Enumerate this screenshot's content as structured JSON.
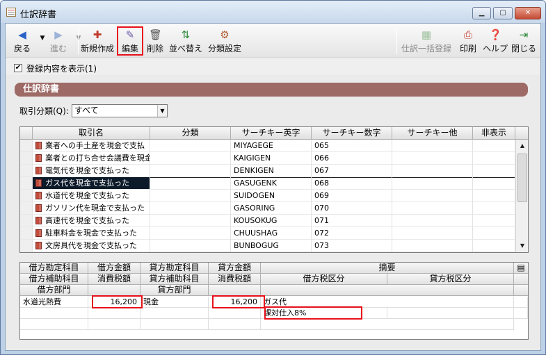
{
  "window": {
    "title": "仕訳辞書"
  },
  "toolbar": {
    "back": "戻る",
    "forward": "進む",
    "new": "新規作成",
    "edit": "編集",
    "delete": "削除",
    "sort": "並べ替え",
    "category": "分類設定",
    "bulk_register": "仕訳一括登録",
    "print": "印刷",
    "help": "ヘルプ",
    "close": "閉じる"
  },
  "options": {
    "show_registered": "登録内容を表示(1)",
    "show_registered_checked": true
  },
  "section": {
    "title": "仕訳辞書"
  },
  "filter": {
    "label": "取引分類(Q):",
    "value": "すべて"
  },
  "grid": {
    "headers": [
      "取引名",
      "分類",
      "サーチキー英字",
      "サーチキー数字",
      "サーチキー他",
      "非表示"
    ],
    "rows": [
      {
        "name": "業者への手土産を現金で支払",
        "category": "",
        "key_alpha": "MIYAGEGE",
        "key_num": "065",
        "key_other": "",
        "hidden": ""
      },
      {
        "name": "業者との打ち合せ会議費を現金",
        "category": "",
        "key_alpha": "KAIGIGEN",
        "key_num": "066",
        "key_other": "",
        "hidden": ""
      },
      {
        "name": "電気代を現金で支払った",
        "category": "",
        "key_alpha": "DENKIGEN",
        "key_num": "067",
        "key_other": "",
        "hidden": ""
      },
      {
        "name": "ガス代を現金で支払った",
        "category": "",
        "key_alpha": "GASUGENK",
        "key_num": "068",
        "key_other": "",
        "hidden": "",
        "selected": true
      },
      {
        "name": "水道代を現金で支払った",
        "category": "",
        "key_alpha": "SUIDOGEN",
        "key_num": "069",
        "key_other": "",
        "hidden": ""
      },
      {
        "name": "ガソリン代を現金で支払った",
        "category": "",
        "key_alpha": "GASORING",
        "key_num": "070",
        "key_other": "",
        "hidden": ""
      },
      {
        "name": "高速代を現金で支払った",
        "category": "",
        "key_alpha": "KOUSOKUG",
        "key_num": "071",
        "key_other": "",
        "hidden": ""
      },
      {
        "name": "駐車料金を現金で支払った",
        "category": "",
        "key_alpha": "CHUUSHAG",
        "key_num": "072",
        "key_other": "",
        "hidden": ""
      },
      {
        "name": "文房具代を現金で支払った",
        "category": "",
        "key_alpha": "BUNBOGUG",
        "key_num": "073",
        "key_other": "",
        "hidden": ""
      }
    ]
  },
  "detail": {
    "headers_row1": [
      "借方勘定科目",
      "借方金額",
      "貸方勘定科目",
      "貸方金額",
      "摘要"
    ],
    "headers_row2": [
      "借方補助科目",
      "消費税額",
      "貸方補助科目",
      "消費税額",
      "借方税区分",
      "貸方税区分"
    ],
    "headers_row3": [
      "借方部門",
      "貸方部門"
    ],
    "entry": {
      "debit_account": "水道光熱費",
      "debit_amount": "16,200",
      "credit_account": "現金",
      "credit_amount": "16,200",
      "summary": "ガス代",
      "debit_tax_class": "課対仕入8%"
    }
  },
  "colors": {
    "section_header": "#9e6a66",
    "highlight": "#e8101a",
    "selection": "#0d1a2a"
  }
}
